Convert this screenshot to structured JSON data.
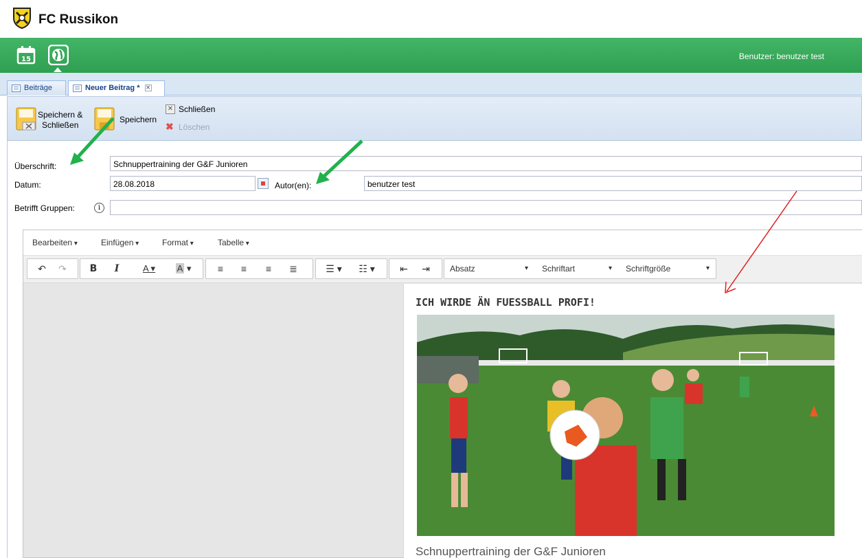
{
  "app": {
    "name": "FC Russikon",
    "user_label": "Benutzer: benutzer test"
  },
  "nav_icons": [
    {
      "icon": "calendar-icon",
      "text": "15"
    },
    {
      "icon": "globe-icon"
    }
  ],
  "tabs": [
    {
      "label": "Beiträge",
      "active": false
    },
    {
      "label": "Neuer Beitrag *",
      "active": true,
      "close": "✕"
    }
  ],
  "toolbar": {
    "save_close_label_1": "Speichern &",
    "save_close_label_2": "Schließen",
    "save_label": "Speichern",
    "close_label": "Schließen",
    "delete_label": "Löschen"
  },
  "form": {
    "title_label": "Überschrift:",
    "title_value": "Schnuppertraining der G&F Junioren",
    "date_label": "Datum:",
    "date_value": "28.08.2018",
    "author_label": "Autor(en):",
    "author_value": "benutzer test",
    "groups_label": "Betrifft Gruppen:",
    "groups_value": "",
    "info_icon": "i"
  },
  "editor": {
    "menus": [
      "Bearbeiten",
      "Einfügen",
      "Format",
      "Tabelle"
    ],
    "format_block": "Absatz",
    "font_family": "Schriftart",
    "font_size": "Schriftgröße",
    "content_heading": "ICH WIRDE ÄN FUESSBALL PROFI!",
    "content_caption": "Schnuppertraining der G&F Junioren"
  },
  "colors": {
    "accent_green": "#3aaa5c",
    "tab_blue": "#15428b",
    "annotation_green": "#22b14c",
    "annotation_red": "#e02020"
  }
}
